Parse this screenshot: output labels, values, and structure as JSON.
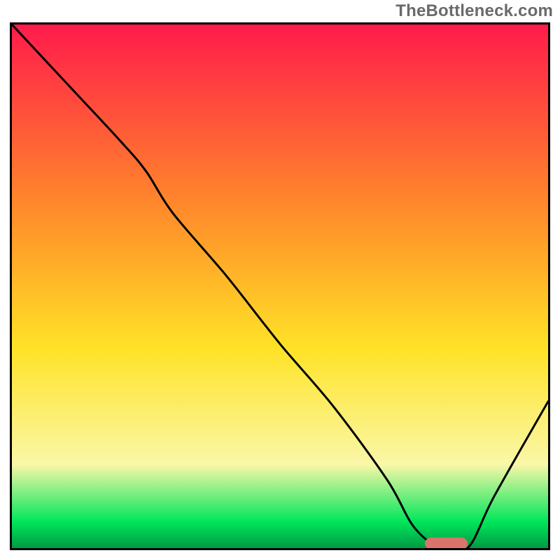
{
  "watermark": "TheBottleneck.com",
  "colors": {
    "border": "#000000",
    "curve": "#000000",
    "marker": "#d9746c",
    "grad_top": "#ff1b4b",
    "grad_mid_upper": "#ff8a2a",
    "grad_mid": "#ffe327",
    "grad_lower": "#faf7a8",
    "grad_green": "#00e65b",
    "grad_green_dark": "#009a44"
  },
  "chart_data": {
    "type": "line",
    "title": "",
    "xlabel": "",
    "ylabel": "",
    "xlim": [
      0,
      100
    ],
    "ylim": [
      0,
      100
    ],
    "legend": false,
    "grid": false,
    "series": [
      {
        "name": "bottleneck-curve",
        "x": [
          0,
          10,
          20,
          25,
          30,
          40,
          50,
          60,
          70,
          75,
          80,
          85,
          90,
          100
        ],
        "y": [
          100,
          89,
          78,
          72,
          64,
          52,
          39,
          27,
          13,
          4,
          0,
          0,
          10,
          28
        ]
      }
    ],
    "marker": {
      "name": "optimal-range",
      "x_start": 77,
      "x_end": 85,
      "y": 0
    },
    "gradient_stops": [
      {
        "pct": 0,
        "color": "#ff1b4b"
      },
      {
        "pct": 35,
        "color": "#ff8a2a"
      },
      {
        "pct": 62,
        "color": "#ffe327"
      },
      {
        "pct": 84,
        "color": "#faf7a8"
      },
      {
        "pct": 95,
        "color": "#00e65b"
      },
      {
        "pct": 100,
        "color": "#009a44"
      }
    ]
  }
}
